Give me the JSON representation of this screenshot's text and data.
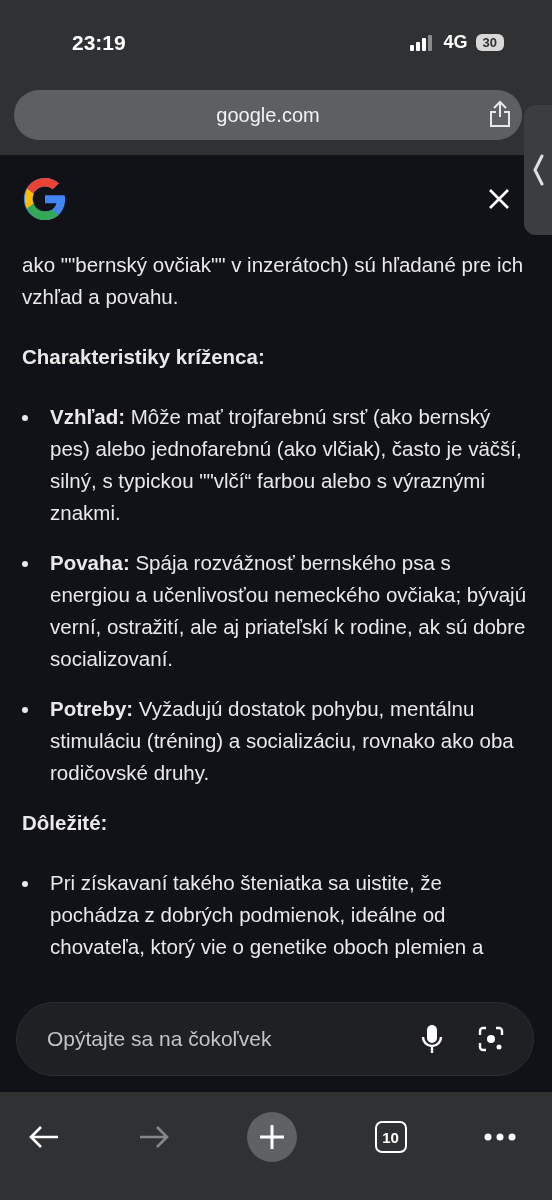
{
  "status_bar": {
    "time": "23:19",
    "network": "4G",
    "battery": "30"
  },
  "address_bar": {
    "url": "google.com"
  },
  "content": {
    "intro": "ako \"\"bernský ovčiak\"\" v inzerátoch) sú hľadané pre ich vzhľad a povahu.",
    "sections": [
      {
        "heading": "Charakteristiky kríženca:",
        "items": [
          "**Vzhľad:** Môže mať trojfarebnú srsť (ako bernský pes) alebo jednofarebnú (ako vlčiak), často je väčší, silný, s typickou \"\"vlčí“ farbou alebo s výraznými znakmi.",
          "**Povaha:** Spája rozvážnosť bernského psa s energiou a učenlivosťou nemeckého ovčiaka; bývajú verní, ostražití, ale aj priateľskí k rodine, ak sú dobre socializovaní.",
          "**Potreby:** Vyžadujú dostatok pohybu, mentálnu stimuláciu (tréning) a socializáciu, rovnako ako oba rodičovské druhy."
        ]
      },
      {
        "heading": "Dôležité:",
        "items": [
          "Pri získavaní takého šteniatka sa uistite, že pochádza z dobrých podmienok, ideálne od chovateľa, ktorý vie o genetike oboch plemien a"
        ]
      }
    ]
  },
  "ask_field": {
    "placeholder": "Opýtajte sa na čokoľvek"
  },
  "toolbar": [
    {
      "kind": "back",
      "disabled": false
    },
    {
      "kind": "forward",
      "disabled": true
    },
    {
      "kind": "new-tab",
      "disabled": false
    },
    {
      "kind": "tabs",
      "label": "10",
      "disabled": false
    },
    {
      "kind": "more",
      "disabled": false
    }
  ]
}
